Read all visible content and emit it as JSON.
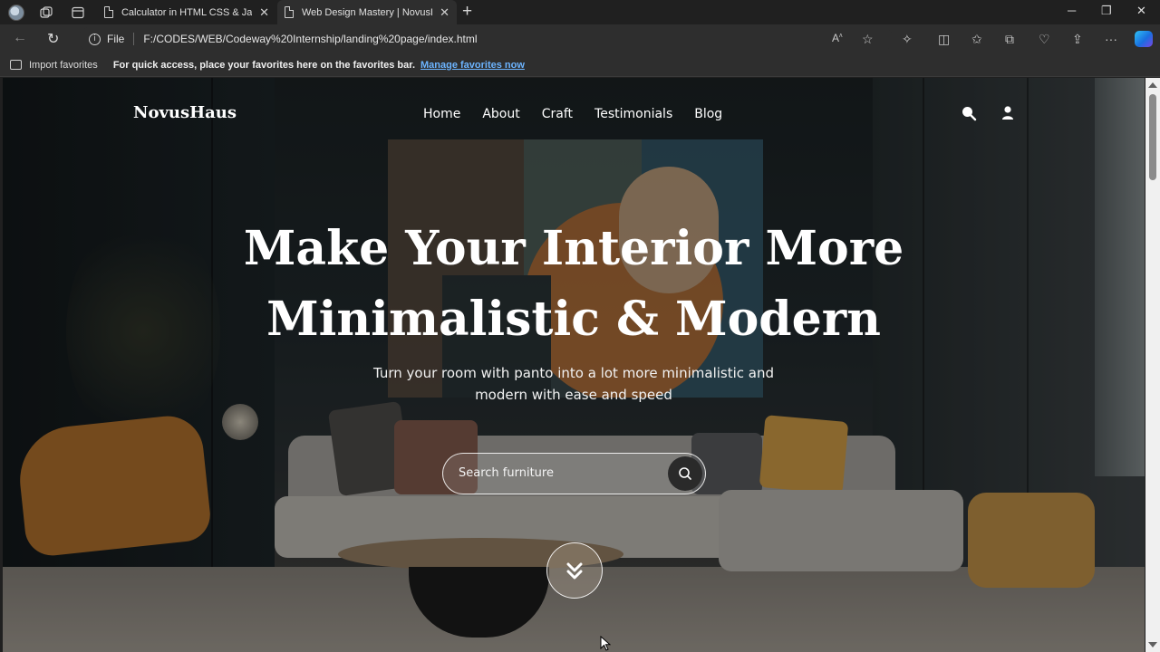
{
  "browser": {
    "tabs": [
      {
        "title": "Calculator in HTML CSS & JavaSc",
        "active": false
      },
      {
        "title": "Web Design Mastery | NovusHaus",
        "active": true
      }
    ],
    "address": {
      "scheme_label": "File",
      "url": "F:/CODES/WEB/Codeway%20Internship/landing%20page/index.html"
    },
    "favorites_bar": {
      "import_label": "Import favorites",
      "message": "For quick access, place your favorites here on the favorites bar.",
      "link_label": "Manage favorites now"
    }
  },
  "site": {
    "logo": "NovusHaus",
    "nav": [
      "Home",
      "About",
      "Craft",
      "Testimonials",
      "Blog"
    ],
    "hero": {
      "headline_line1": "Make Your Interior More",
      "headline_line2": "Minimalistic & Modern",
      "subtitle_line1": "Turn your room with panto into a lot more minimalistic and",
      "subtitle_line2": "modern with ease and speed",
      "search_placeholder": "Search furniture"
    }
  },
  "colors": {
    "link": "#6cb4ff",
    "text_on_hero": "#ffffff"
  }
}
